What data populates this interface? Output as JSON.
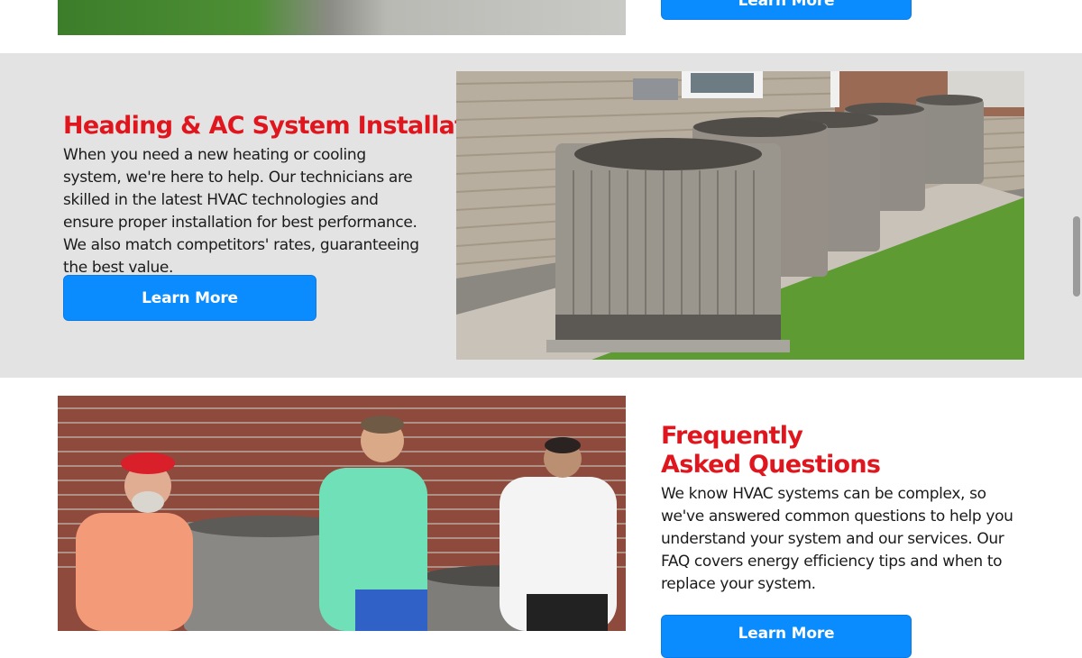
{
  "top_section": {
    "learn_more_label": "Learn More"
  },
  "install_section": {
    "heading": "Heading & AC System Installation",
    "text": "When you need a new heating or cooling system, we're here to help. Our technicians are skilled in the latest HVAC technologies and ensure proper installation for best performance. We also match competitors' rates, guaranteeing the best value.",
    "learn_more_label": "Learn More"
  },
  "faq_section": {
    "heading_line1": "Frequently",
    "heading_line2": "Asked Questions",
    "text": "We know HVAC systems can be complex, so we've answered common questions to help you understand your system and our services. Our FAQ covers energy efficiency tips and when to replace your system.",
    "learn_more_label": "Learn More"
  },
  "colors": {
    "accent_button": "#0a8cff",
    "heading_red": "#e0161e",
    "band_grey": "#e3e3e3"
  }
}
